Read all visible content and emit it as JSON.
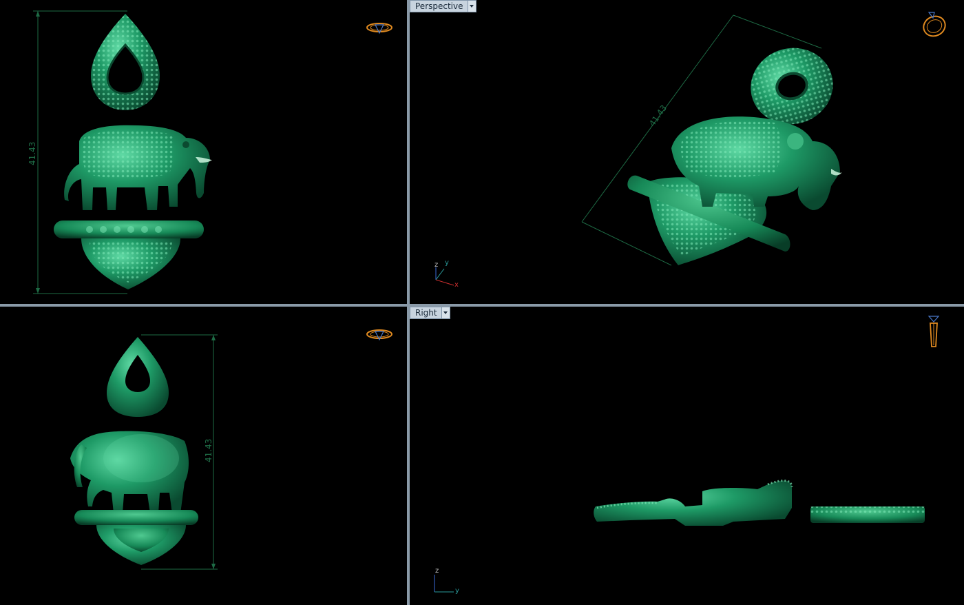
{
  "viewports": {
    "top_left": {
      "dimension": "41.43"
    },
    "top_right": {
      "label": "Perspective",
      "dimension": "41.43",
      "axes": {
        "z": "z",
        "y": "y",
        "x": "x"
      }
    },
    "bottom_left": {
      "dimension": "41.43"
    },
    "bottom_right": {
      "label": "Right",
      "axes": {
        "z": "z",
        "y": "y"
      }
    }
  },
  "colors": {
    "viewport_bg": "#000000",
    "divider": "#8a9aa8",
    "model_green": "#1a8a5e",
    "dimension_line": "#1e6b45",
    "nav_icon": "#e08a20"
  },
  "icons": {
    "top_left": "gem-ring-nav-icon",
    "top_right": "ring-perspective-nav-icon",
    "bottom_left": "gem-ring-nav-icon",
    "bottom_right": "ring-side-nav-icon"
  }
}
